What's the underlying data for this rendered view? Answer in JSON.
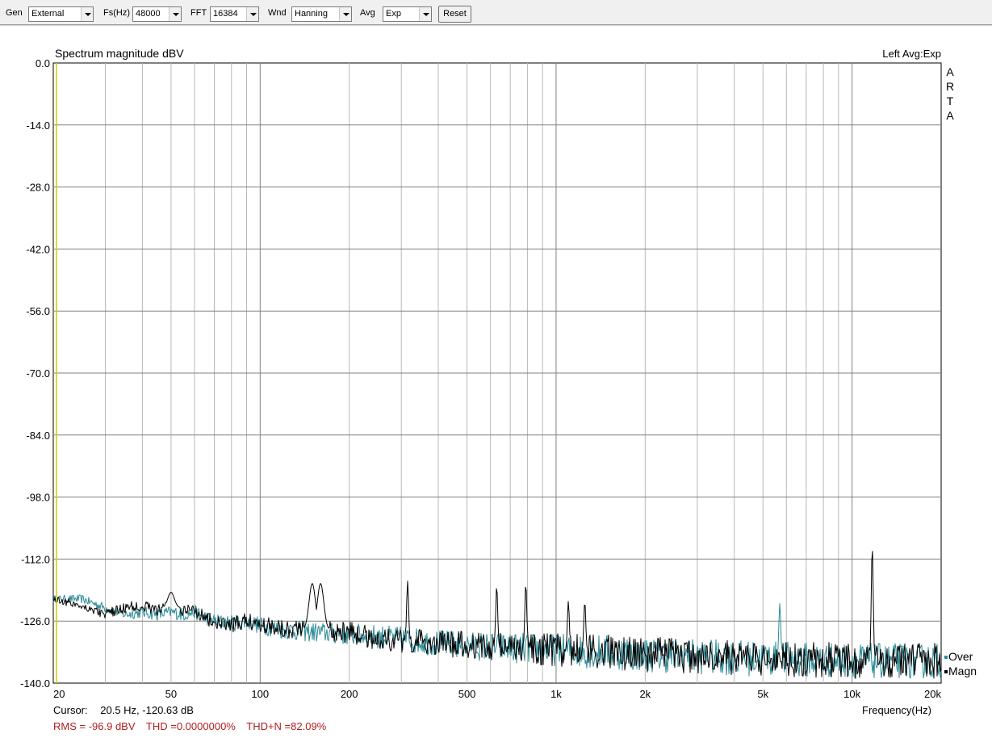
{
  "toolbar": {
    "gen_label": "Gen",
    "gen_value": "External",
    "fs_label": "Fs(Hz)",
    "fs_value": "48000",
    "fft_label": "FFT",
    "fft_value": "16384",
    "wnd_label": "Wnd",
    "wnd_value": "Hanning",
    "avg_label": "Avg",
    "avg_value": "Exp",
    "reset_label": "Reset"
  },
  "plot": {
    "right_title": "Left  Avg:Exp",
    "brand_letters": [
      "A",
      "R",
      "T",
      "A"
    ],
    "legend": [
      {
        "label": "Over",
        "color": "#2a8a96"
      },
      {
        "label": "Magn",
        "color": "#000000"
      }
    ],
    "cursor_prefix": "Cursor:",
    "cursor_value": "20.5 Hz, -120.63 dB",
    "rms": "RMS =  -96.9 dBV",
    "thd": "THD =0.0000000%",
    "thdn": "THD+N =82.09%"
  },
  "chart_data": {
    "type": "line",
    "title": "Spectrum magnitude dBV",
    "xlabel": "Frequency(Hz)",
    "ylabel": "",
    "xscale": "log",
    "xlim": [
      20,
      20000
    ],
    "ylim": [
      -140,
      0
    ],
    "grid": true,
    "legend_position": "bottom-right",
    "y_ticks": [
      "0.0",
      "-14.0",
      "-28.0",
      "-42.0",
      "-56.0",
      "-70.0",
      "-84.0",
      "-98.0",
      "-112.0",
      "-126.0",
      "-140.0"
    ],
    "x_ticks": [
      {
        "value": 20,
        "label": "20"
      },
      {
        "value": 50,
        "label": "50"
      },
      {
        "value": 100,
        "label": "100"
      },
      {
        "value": 200,
        "label": "200"
      },
      {
        "value": 500,
        "label": "500"
      },
      {
        "value": 1000,
        "label": "1k"
      },
      {
        "value": 2000,
        "label": "2k"
      },
      {
        "value": 5000,
        "label": "5k"
      },
      {
        "value": 10000,
        "label": "10k"
      },
      {
        "value": 20000,
        "label": "20k"
      }
    ],
    "cursor_x": 20.5,
    "series": [
      {
        "name": "Magn",
        "color": "#000000",
        "baseline": [
          [
            20,
            -121
          ],
          [
            25,
            -122.5
          ],
          [
            30,
            -124.5
          ],
          [
            35,
            -123
          ],
          [
            40,
            -122.5
          ],
          [
            45,
            -123.5
          ],
          [
            50,
            -123
          ],
          [
            55,
            -124
          ],
          [
            60,
            -123.5
          ],
          [
            70,
            -126.5
          ],
          [
            80,
            -127
          ],
          [
            90,
            -126
          ],
          [
            100,
            -126.5
          ],
          [
            120,
            -127.5
          ],
          [
            150,
            -128
          ],
          [
            200,
            -128.5
          ],
          [
            250,
            -130
          ],
          [
            300,
            -130.5
          ],
          [
            400,
            -131
          ],
          [
            500,
            -131.5
          ],
          [
            700,
            -132
          ],
          [
            1000,
            -132.5
          ],
          [
            1500,
            -133
          ],
          [
            2000,
            -133.5
          ],
          [
            3000,
            -134
          ],
          [
            5000,
            -134.5
          ],
          [
            8000,
            -134.8
          ],
          [
            12000,
            -135
          ],
          [
            20000,
            -135
          ]
        ],
        "peaks": [
          {
            "x": 50,
            "y": -119.5
          },
          {
            "x": 150,
            "y": -117.5
          },
          {
            "x": 160,
            "y": -117.5
          },
          {
            "x": 315,
            "y": -117
          },
          {
            "x": 630,
            "y": -118
          },
          {
            "x": 790,
            "y": -117.5
          },
          {
            "x": 1100,
            "y": -121.5
          },
          {
            "x": 1250,
            "y": -121.5
          },
          {
            "x": 11700,
            "y": -109
          }
        ]
      },
      {
        "name": "Over",
        "color": "#2a8a96",
        "baseline": [
          [
            20,
            -121
          ],
          [
            25,
            -121
          ],
          [
            30,
            -123
          ],
          [
            35,
            -124.5
          ],
          [
            40,
            -124
          ],
          [
            45,
            -124.5
          ],
          [
            50,
            -124
          ],
          [
            55,
            -124.5
          ],
          [
            60,
            -124
          ],
          [
            70,
            -126
          ],
          [
            80,
            -126.5
          ],
          [
            90,
            -126
          ],
          [
            100,
            -127
          ],
          [
            120,
            -128
          ],
          [
            150,
            -128.5
          ],
          [
            200,
            -129
          ],
          [
            250,
            -129.5
          ],
          [
            300,
            -130
          ],
          [
            400,
            -131
          ],
          [
            500,
            -131.5
          ],
          [
            700,
            -132
          ],
          [
            1000,
            -132.5
          ],
          [
            1500,
            -133
          ],
          [
            2000,
            -133.5
          ],
          [
            3000,
            -134
          ],
          [
            5000,
            -134.5
          ],
          [
            8000,
            -134.8
          ],
          [
            12000,
            -135
          ],
          [
            20000,
            -135
          ]
        ],
        "peaks": [
          {
            "x": 5700,
            "y": -122
          }
        ]
      }
    ]
  }
}
